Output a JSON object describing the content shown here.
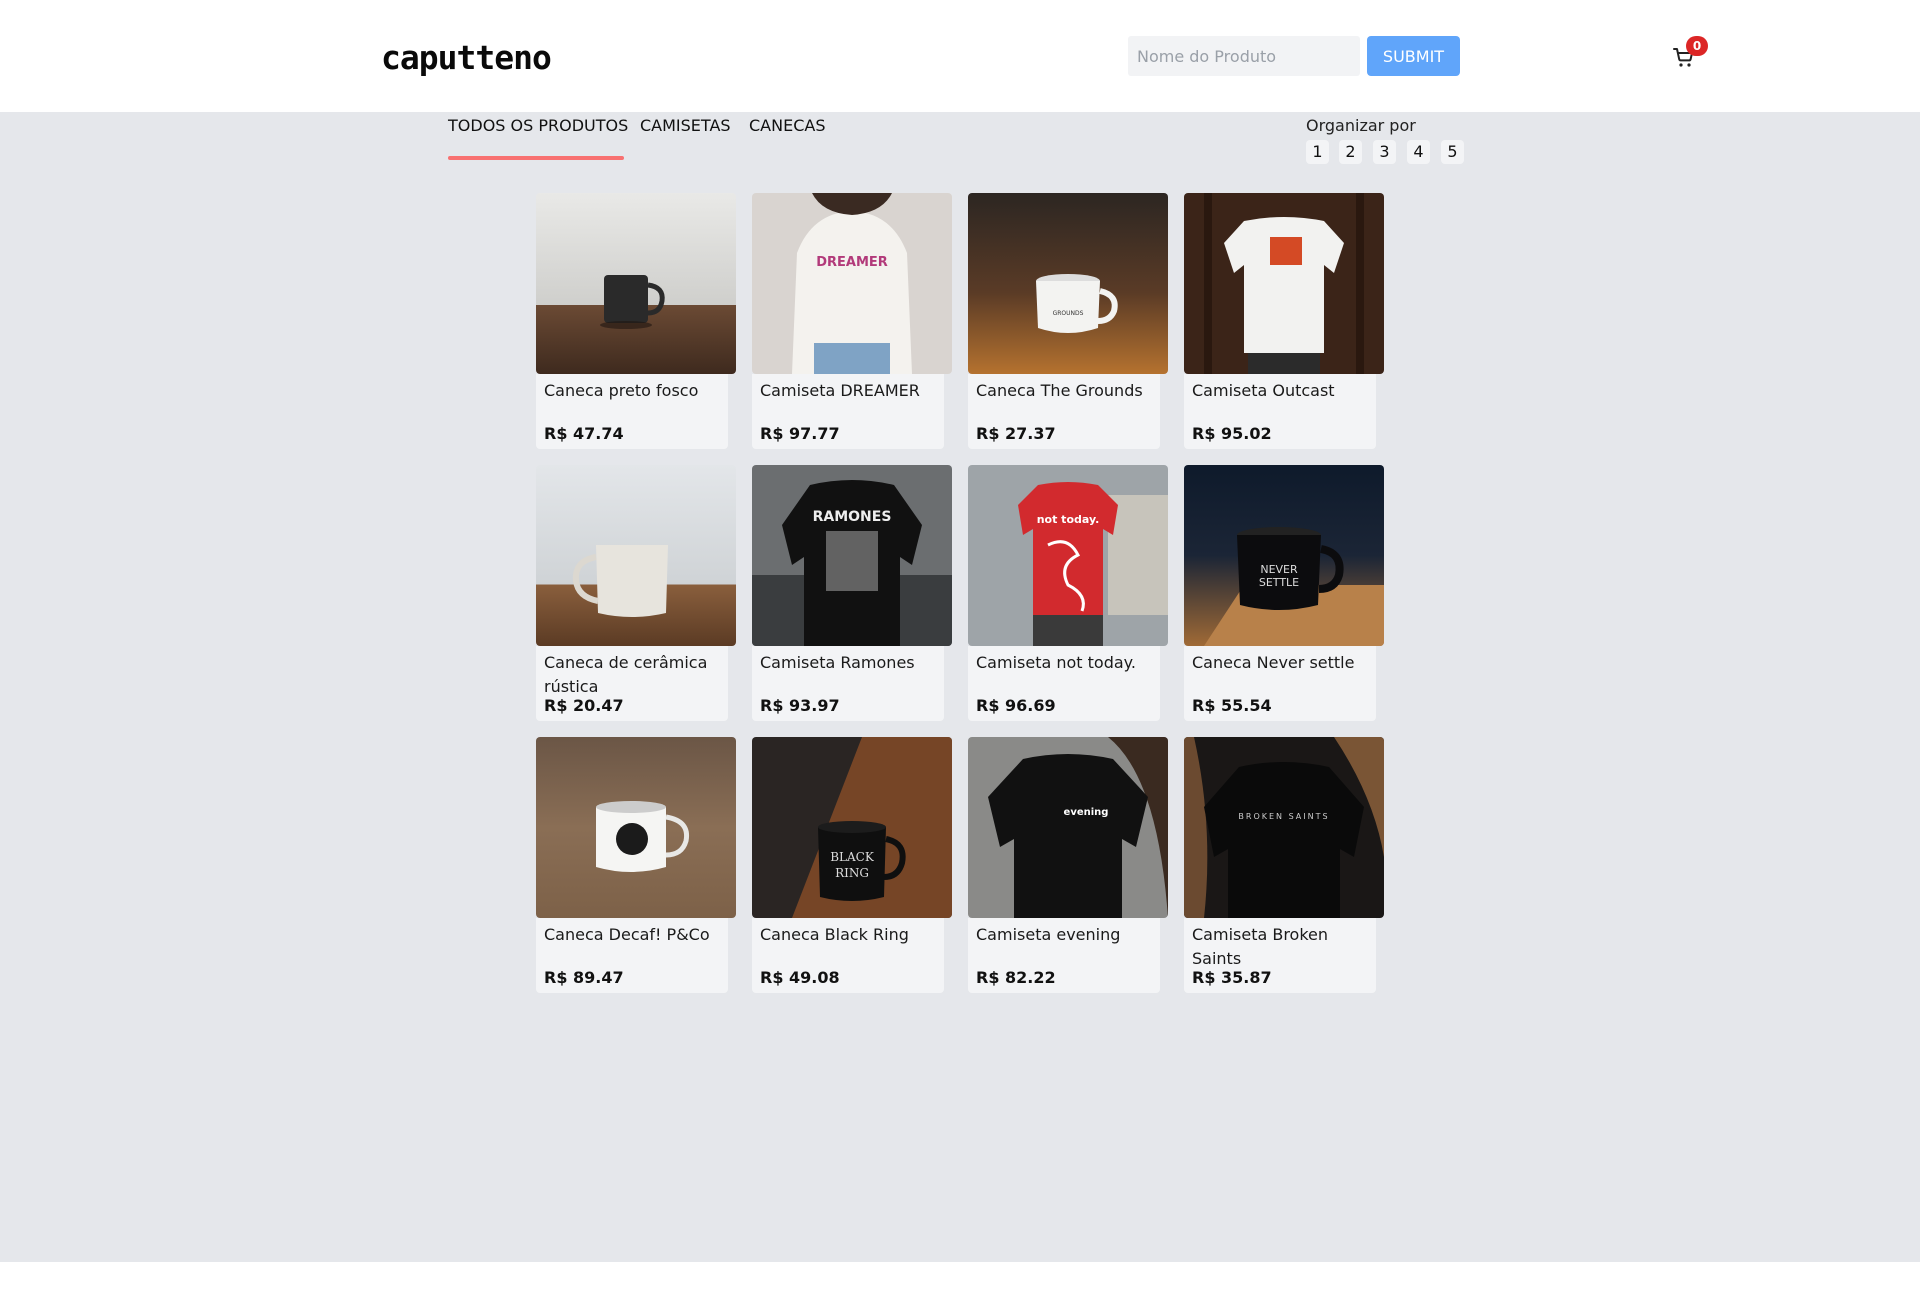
{
  "header": {
    "logo": "caputteno",
    "search_placeholder": "Nome do Produto",
    "submit_label": "SUBMIT",
    "cart_count": "0"
  },
  "tabs": [
    {
      "label": "TODOS OS PRODUTOS",
      "active": true
    },
    {
      "label": "CAMISETAS",
      "active": false
    },
    {
      "label": "CANECAS",
      "active": false
    }
  ],
  "sort": {
    "label": "Organizar por",
    "pages": [
      "1",
      "2",
      "3",
      "4",
      "5"
    ]
  },
  "products": [
    {
      "title": "Caneca preto fosco",
      "price": "R$ 47.74"
    },
    {
      "title": "Camiseta DREAMER",
      "price": "R$ 97.77"
    },
    {
      "title": "Caneca The Grounds",
      "price": "R$ 27.37"
    },
    {
      "title": "Camiseta Outcast",
      "price": "R$ 95.02"
    },
    {
      "title": "Caneca de cerâmica rústica",
      "price": "R$ 20.47"
    },
    {
      "title": "Camiseta Ramones",
      "price": "R$ 93.97"
    },
    {
      "title": "Camiseta not today.",
      "price": "R$ 96.69"
    },
    {
      "title": "Caneca Never settle",
      "price": "R$ 55.54"
    },
    {
      "title": "Caneca Decaf! P&Co",
      "price": "R$ 89.47"
    },
    {
      "title": "Caneca Black Ring",
      "price": "R$ 49.08"
    },
    {
      "title": "Camiseta evening",
      "price": "R$ 82.22"
    },
    {
      "title": "Camiseta Broken Saints",
      "price": "R$ 35.87"
    }
  ],
  "colors": {
    "accent": "#60a5fa",
    "tab_underline": "#f87171",
    "badge": "#dc2626",
    "background": "#e5e7eb"
  }
}
